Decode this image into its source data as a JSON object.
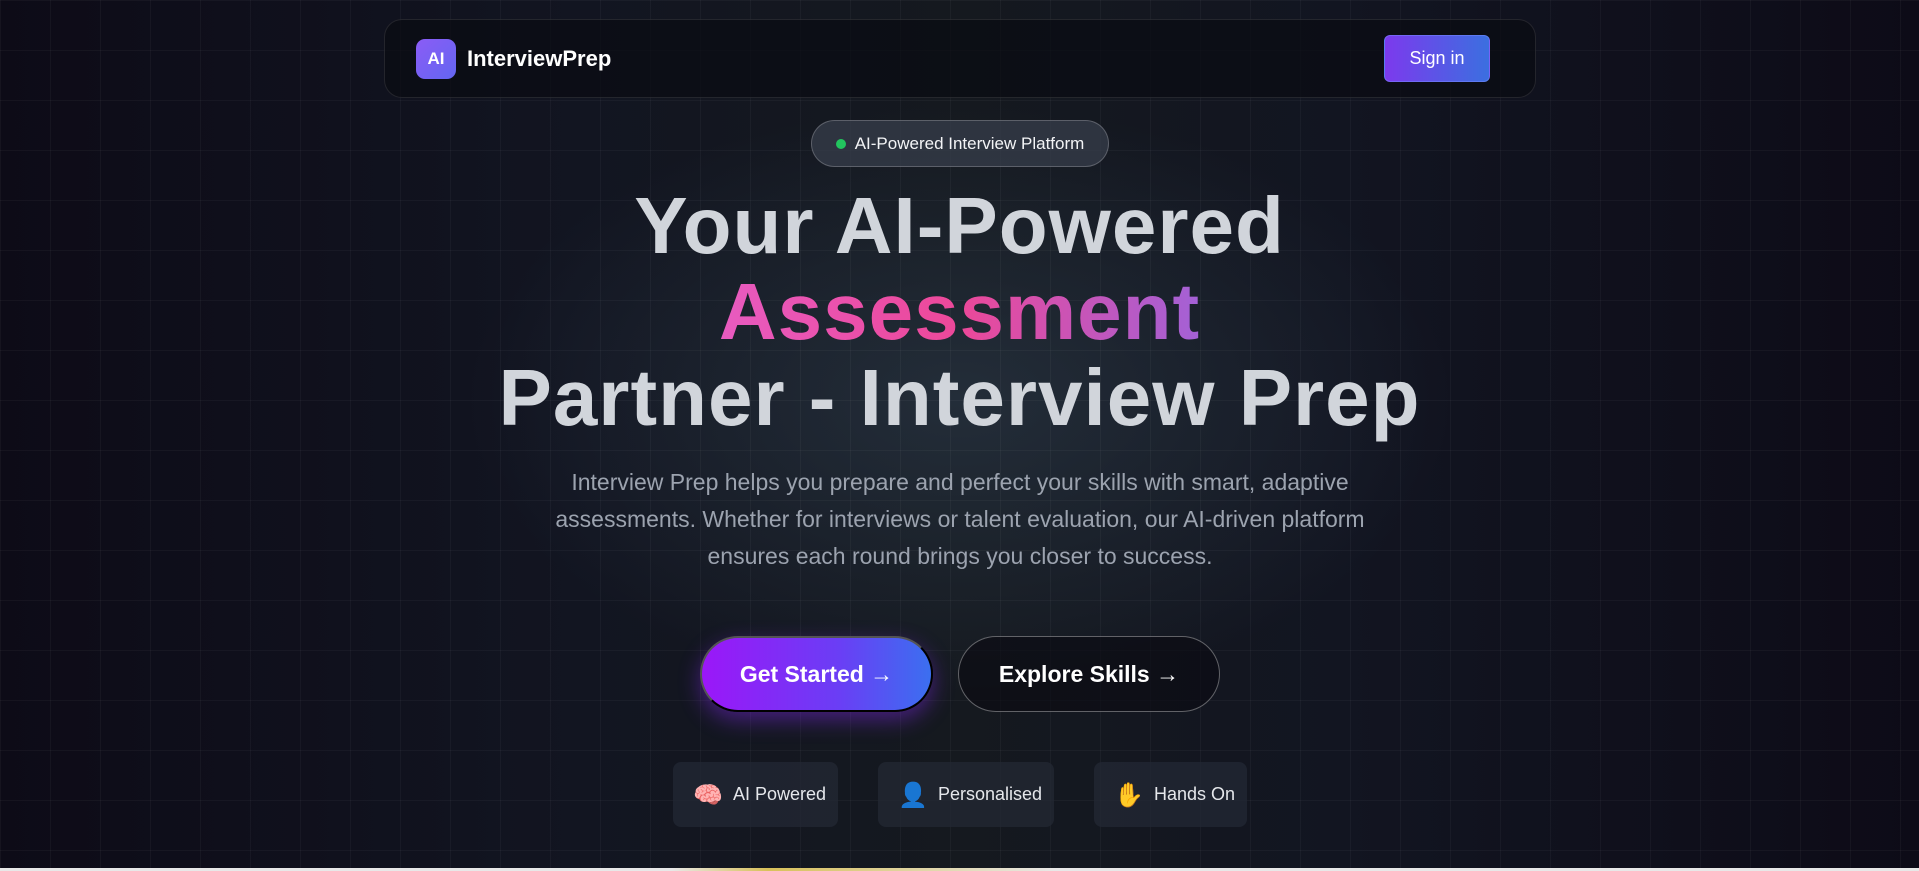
{
  "navbar": {
    "logo_text": "AI",
    "brand_name": "InterviewPrep",
    "signin_label": "Sign in"
  },
  "badge": {
    "label": "AI-Powered Interview Platform",
    "dot_color": "#22c55e"
  },
  "hero": {
    "line1": "Your AI-Powered",
    "line2": "Assessment",
    "line3": "Partner - Interview Prep",
    "description": "Interview Prep helps you prepare and perfect your skills with smart, adaptive assessments. Whether for interviews or talent evaluation, our AI-driven platform ensures each round brings you closer to success.",
    "gradient_colors": [
      "#e85bc0",
      "#ec4899",
      "#a361d6"
    ]
  },
  "cta": {
    "primary_label": "Get Started →",
    "secondary_label": "Explore Skills →"
  },
  "features": [
    {
      "icon": "brain-icon",
      "glyph": "🧠",
      "label": "AI Powered"
    },
    {
      "icon": "person-icon",
      "glyph": "👤",
      "label": "Personalised"
    },
    {
      "icon": "raised-hand-icon",
      "glyph": "✋",
      "label": "Hands On"
    }
  ],
  "colors": {
    "background": "#0b0b14",
    "accent_purple": "#7c3aed",
    "accent_blue": "#3b6ff0"
  }
}
